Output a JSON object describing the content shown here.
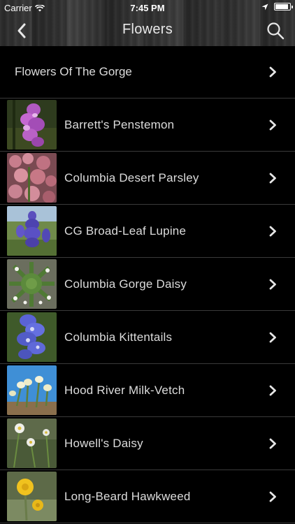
{
  "status_bar": {
    "carrier": "Carrier",
    "time": "7:45 PM",
    "battery_level": 0.9
  },
  "nav": {
    "title": "Flowers",
    "back_icon": "chevron-left-icon",
    "search_icon": "search-icon"
  },
  "section": {
    "label": "Flowers Of The Gorge"
  },
  "flowers": [
    {
      "name": "Barrett's Penstemon"
    },
    {
      "name": "Columbia Desert Parsley"
    },
    {
      "name": "CG Broad-Leaf Lupine"
    },
    {
      "name": "Columbia Gorge Daisy"
    },
    {
      "name": "Columbia Kittentails"
    },
    {
      "name": "Hood River Milk-Vetch"
    },
    {
      "name": "Howell's Daisy"
    },
    {
      "name": "Long-Beard Hawkweed"
    }
  ],
  "colors": {
    "background": "#000000",
    "separator": "#3a3a3a",
    "text": "#dcdcdc",
    "chevron": "#e6e6e6"
  }
}
